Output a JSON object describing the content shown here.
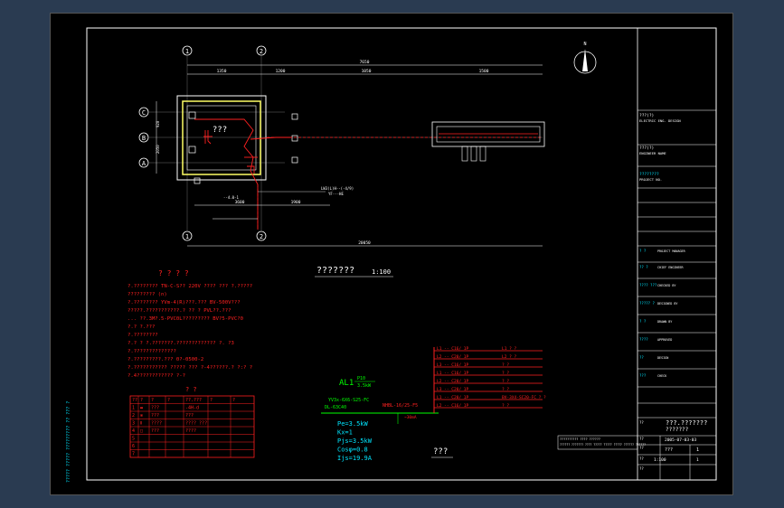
{
  "plan": {
    "axes_x": [
      "1",
      "2"
    ],
    "axes_y": [
      "C",
      "B",
      "A"
    ],
    "dims_top": [
      "7650",
      "1350",
      "1200",
      "1050",
      "1500"
    ],
    "dims_right_labels": [
      "920",
      "2050",
      "920"
    ],
    "dim_bottom": "20050",
    "dim_mid_a": "3600",
    "dim_mid_b": "1900",
    "room_label": "???",
    "label_call1": "LW3(L)H--(-4/9)",
    "label_call2": "YF---HE",
    "label_down": "--4.0-1",
    "title": "???????",
    "scale": "1:100"
  },
  "notes": {
    "title": "? ? ? ?",
    "lines": [
      "?.???????? TN-C-S?? 220V ???? ??? ?.?????",
      "     ?????????  (n)",
      "?.????????  YVm-4(R)???.???  BV-500V???",
      "     ?????.???????????.?    ?? ? PVL??.???",
      "          ... ??.3M?.5-PVC0L?????????  BV?5-PVC?0",
      "?.?   ?.???",
      "?.????????",
      "?.? ?  ?.???????.?????????????   ?. ?3",
      "?.??????????????",
      "?.?????????.???        0?-0500-2",
      "?.??????????? ????? ???  ?-4??????.? ?:? ?",
      "     ?.4????????????  ?-?"
    ]
  },
  "legend": {
    "title": "?   ?",
    "headers": [
      "??",
      "?",
      "?",
      "?",
      "??.???",
      "?",
      "?"
    ],
    "rows": [
      [
        "1",
        "▬",
        "???",
        "",
        "-4H-d",
        "",
        ""
      ],
      [
        "2",
        "⊗",
        "???",
        "",
        "???",
        "",
        ""
      ],
      [
        "3",
        "Ⅱ",
        "????",
        "",
        "???? ???",
        "",
        ""
      ],
      [
        "4",
        "□",
        "???",
        "",
        "????",
        "",
        ""
      ],
      [
        "5",
        "",
        "",
        "",
        "",
        "",
        ""
      ],
      [
        "6",
        "",
        "",
        "",
        "",
        "",
        ""
      ],
      [
        "7",
        "",
        "",
        "",
        "",
        "",
        ""
      ]
    ]
  },
  "diagram": {
    "panel": "AL1",
    "panel_top": "P10",
    "panel_power": "3.5kW",
    "feeder": "YV3x-6X6-S25-FC",
    "breaker_left": "DL-63C40",
    "breaker_right": "NHBL-16/25-F5",
    "meter": "~30mA",
    "circuits": [
      {
        "left": "L1 -- C16/ 1P",
        "right": "L1 ?  ?"
      },
      {
        "left": "L2 -- C20/ 1P",
        "right": "L2 ?  ?"
      },
      {
        "left": "L3 -- C16/ 1P",
        "right": "?  ?"
      },
      {
        "left": "L1 -- C16/ 1P",
        "right": "?  ?"
      },
      {
        "left": "L2 -- C20/ 1P",
        "right": "?  ?"
      },
      {
        "left": "L3 -- C20/ 1P",
        "right": "?  ?"
      },
      {
        "left": "L1 -- C20/ 1P",
        "right": "BV-3X4-SC20-FC   ?  ?"
      },
      {
        "left": "L2 -- C16/ 1P",
        "right": "?  ?"
      }
    ],
    "params": [
      "Pe=3.5kW",
      "Kx=1",
      "Pjs=3.5kW",
      "Cosφ=0.8",
      "Ijs=19.9A"
    ],
    "title": "???"
  },
  "title_block": {
    "sec1_a": "???(?)",
    "sec1_b": "ELECTRIC ENG. DESIGN",
    "sec2_a": "???(?)",
    "sec2_b": "ENGINEER NAME",
    "sec3_cyan": "????????",
    "sec3_b": "PROJECT NO.",
    "rows": [
      {
        "label": "? ?",
        "value": "PROJECT MANAGER"
      },
      {
        "label": "?? ?",
        "value": "CHIEF ENGINEER"
      },
      {
        "label": "???? ???",
        "value": "CHECKED BY"
      },
      {
        "label": "????? ?",
        "value": "DESIGNED BY"
      },
      {
        "label": "? ?",
        "value": "DRAWN BY"
      },
      {
        "label": "????",
        "value": "APPROVED"
      },
      {
        "label": "??",
        "value": "DESIGN"
      },
      {
        "label": "???",
        "value": "CHECK"
      }
    ],
    "drawing_name_label": "??",
    "drawing_name": "???.???????",
    "drawing_name2": "???????",
    "date_label": "??",
    "date": "2005-07-03-03",
    "no_label": "??",
    "no_value": "???",
    "sheet_label": "??",
    "sheet_value": "1",
    "scale_label": "??",
    "scale_value": "1:100",
    "page": "1"
  },
  "bottom_strip": {
    "line1": "?????????? ???? ??????",
    "line2": "?????? ??????? ???? ????? ????? ????? ?????? ??????"
  },
  "side_note": "????? ????? ????????? ?? ??? ?",
  "compass_label": "N",
  "colors": {
    "background": "#2a3b51",
    "sheet": "#000000",
    "frame": "#ffffff",
    "red": "#ff2020",
    "cyan": "#00e5ff",
    "green": "#00ff00"
  }
}
